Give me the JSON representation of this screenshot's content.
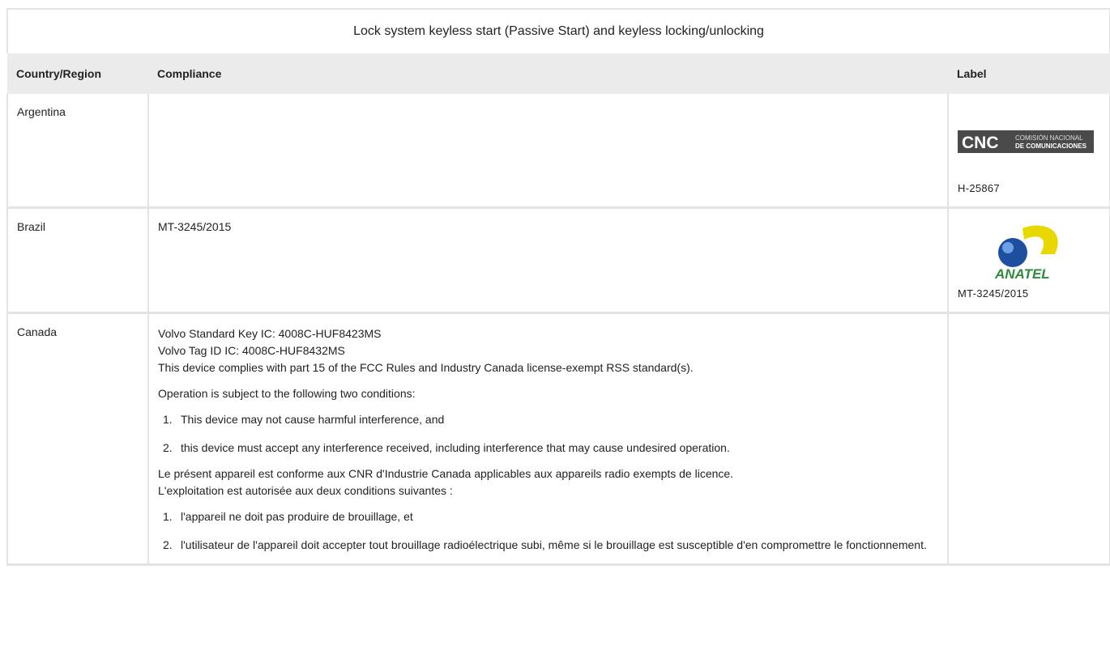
{
  "title": "Lock system keyless start (Passive Start) and keyless locking/unlocking",
  "headers": {
    "country": "Country/Region",
    "compliance": "Compliance",
    "label": "Label"
  },
  "rows": [
    {
      "country": "Argentina",
      "compliance": "",
      "label_text": "H-25867",
      "logo": {
        "mark": "CNC",
        "line1": "COMISIÓN NACIONAL",
        "line2": "DE COMUNICACIONES"
      }
    },
    {
      "country": "Brazil",
      "compliance": "MT-3245/2015",
      "label_text": "MT-3245/2015",
      "logo": {
        "mark": "ANATEL"
      }
    }
  ],
  "canada": {
    "country": "Canada",
    "line1": "Volvo Standard Key IC: 4008C-HUF8423MS",
    "line2": "Volvo Tag ID IC: 4008C-HUF8432MS",
    "line3": "This device complies with part 15 of the FCC Rules and Industry Canada license-exempt RSS standard(s).",
    "conditions_intro": "Operation is subject to the following two conditions:",
    "conditions": [
      {
        "num": "1.",
        "text": "This device may not cause harmful interference, and"
      },
      {
        "num": "2.",
        "text": "this device must accept any interference received, including interference that may cause undesired operation."
      }
    ],
    "fr_line1": "Le présent appareil est conforme aux CNR d'Industrie Canada applicables aux appareils radio exempts de licence.",
    "fr_line2": "L'exploitation est autorisée aux deux conditions suivantes :",
    "fr_conditions": [
      {
        "num": "1.",
        "text": "l'appareil ne doit pas produire de brouillage, et"
      },
      {
        "num": "2.",
        "text": "l'utilisateur de l'appareil doit accepter tout brouillage radioélectrique subi, même si le brouillage est susceptible d'en compromettre le fonctionnement."
      }
    ]
  },
  "colors": {
    "header_bg": "#ebebeb",
    "border": "#e3e3e3",
    "anatel_yellow": "#e8d800",
    "anatel_green": "#2f8a3c",
    "anatel_blue": "#1c4fa0",
    "cnc_gray": "#4a4a4a"
  }
}
